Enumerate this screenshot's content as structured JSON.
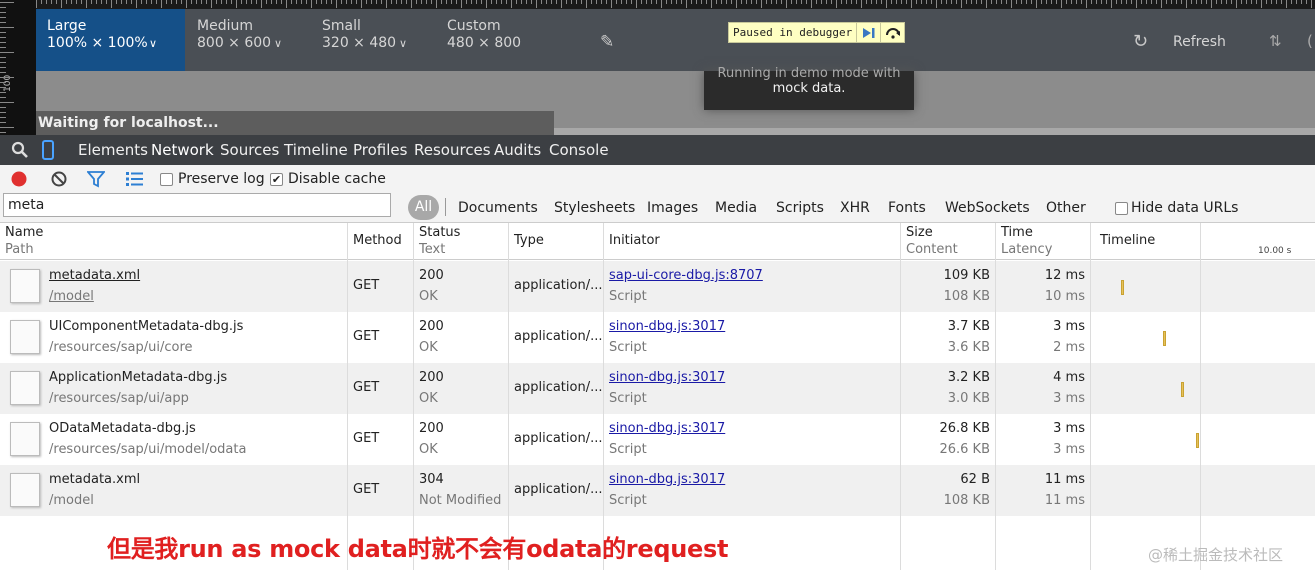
{
  "device_bar": {
    "presets": [
      {
        "name": "Large",
        "size": "100% × 100%"
      },
      {
        "name": "Medium",
        "size": "800 × 600"
      },
      {
        "name": "Small",
        "size": "320 × 480"
      },
      {
        "name": "Custom",
        "size": "480 × 800"
      }
    ],
    "paused_label": "Paused in debugger",
    "refresh_label": "Refresh",
    "ruler_label": "100"
  },
  "page": {
    "banner_line1": "Running in demo mode with",
    "banner_line2": "mock data.",
    "status": "Waiting for localhost..."
  },
  "devtools": {
    "tabs": [
      "Elements",
      "Network",
      "Sources",
      "Timeline",
      "Profiles",
      "Resources",
      "Audits",
      "Console"
    ],
    "active_tab": "Network"
  },
  "toolbar": {
    "preserve_log": "Preserve log",
    "disable_cache": "Disable cache"
  },
  "filter": {
    "value": "meta",
    "chips": [
      "All",
      "Documents",
      "Stylesheets",
      "Images",
      "Media",
      "Scripts",
      "XHR",
      "Fonts",
      "WebSockets",
      "Other"
    ],
    "hide_data_urls": "Hide data URLs"
  },
  "columns": {
    "name": "Name",
    "name_sub": "Path",
    "method": "Method",
    "status": "Status",
    "status_sub": "Text",
    "type": "Type",
    "initiator": "Initiator",
    "size": "Size",
    "size_sub": "Content",
    "time": "Time",
    "time_sub": "Latency",
    "timeline": "Timeline",
    "timeline_scale": "10.00 s"
  },
  "requests": [
    {
      "name": "metadata.xml",
      "path": "/model",
      "method": "GET",
      "status": "200",
      "status_text": "OK",
      "type": "application/...",
      "initiator": "sap-ui-core-dbg.js:8707",
      "initiator_type": "Script",
      "size": "109 KB",
      "content": "108 KB",
      "time": "12 ms",
      "latency": "10 ms",
      "timeline_pos": 0.006
    },
    {
      "name": "UIComponentMetadata-dbg.js",
      "path": "/resources/sap/ui/core",
      "method": "GET",
      "status": "200",
      "status_text": "OK",
      "type": "application/...",
      "initiator": "sinon-dbg.js:3017",
      "initiator_type": "Script",
      "size": "3.7 KB",
      "content": "3.6 KB",
      "time": "3 ms",
      "latency": "2 ms",
      "timeline_pos": 0.103
    },
    {
      "name": "ApplicationMetadata-dbg.js",
      "path": "/resources/sap/ui/app",
      "method": "GET",
      "status": "200",
      "status_text": "OK",
      "type": "application/...",
      "initiator": "sinon-dbg.js:3017",
      "initiator_type": "Script",
      "size": "3.2 KB",
      "content": "3.0 KB",
      "time": "4 ms",
      "latency": "3 ms",
      "timeline_pos": 0.146
    },
    {
      "name": "ODataMetadata-dbg.js",
      "path": "/resources/sap/ui/model/odata",
      "method": "GET",
      "status": "200",
      "status_text": "OK",
      "type": "application/...",
      "initiator": "sinon-dbg.js:3017",
      "initiator_type": "Script",
      "size": "26.8 KB",
      "content": "26.6 KB",
      "time": "3 ms",
      "latency": "3 ms",
      "timeline_pos": 0.18
    },
    {
      "name": "metadata.xml",
      "path": "/model",
      "method": "GET",
      "status": "304",
      "status_text": "Not Modified",
      "type": "application/...",
      "initiator": "sinon-dbg.js:3017",
      "initiator_type": "Script",
      "size": "62 B",
      "content": "108 KB",
      "time": "11 ms",
      "latency": "11 ms",
      "timeline_pos": null
    }
  ],
  "annotation": "但是我run as mock data时就不会有odata的request",
  "watermark": "@稀土掘金技术社区",
  "colors": {
    "active_preset": "#155088",
    "link": "#1a1aa6",
    "record": "#e0302f",
    "annotation": "#e02020",
    "timeline_bar": "#e6c15a"
  }
}
